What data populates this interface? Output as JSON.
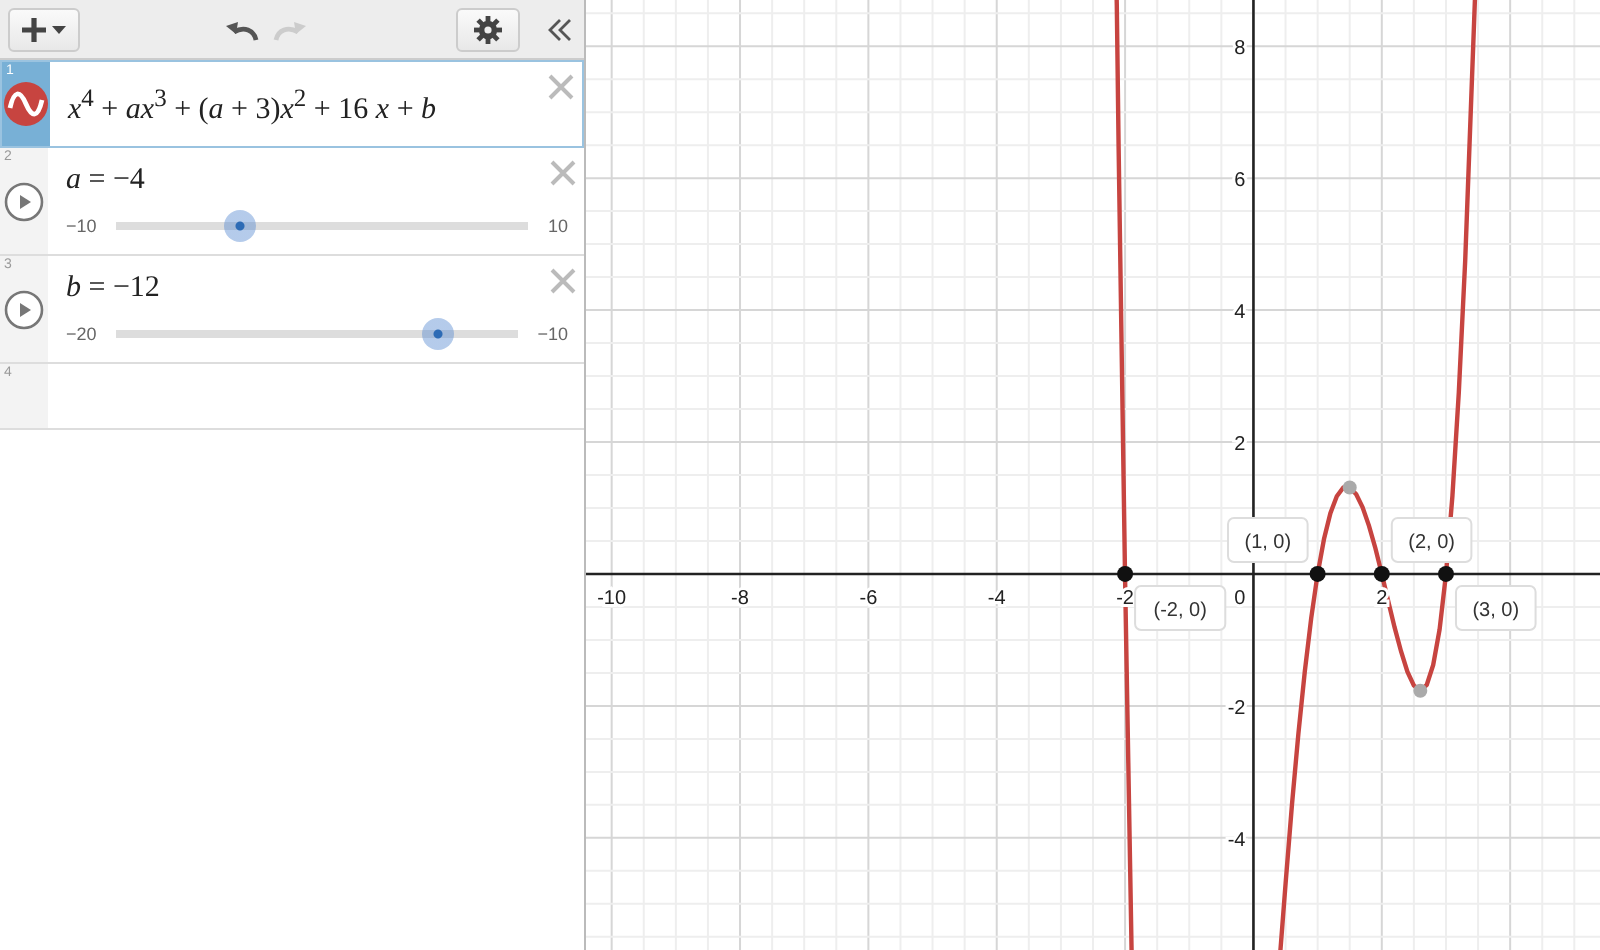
{
  "toolbar": {
    "undo_disabled": false,
    "redo_disabled": true
  },
  "expressions": [
    {
      "kind": "expression",
      "number": "1",
      "selected": true,
      "color": "#c74440",
      "latex": "*x*$^{4}$ + *ax*$^{3}$ + (*a* + 3)*x*$^{2}$ + 16 *x* + *b*"
    },
    {
      "kind": "slider",
      "number": "2",
      "selected": false,
      "latex": "*a* = −4",
      "min": "−10",
      "max": "10",
      "level": 0.3
    },
    {
      "kind": "slider",
      "number": "3",
      "selected": false,
      "latex": "*b* = −12",
      "min": "−20",
      "max": "−10",
      "level": 0.8
    },
    {
      "kind": "empty",
      "number": "4",
      "selected": false
    }
  ],
  "graph": {
    "origin_label": "0",
    "show_extrema": true,
    "chart_data": {
      "type": "line",
      "xlim": [
        -10.4,
        5.4
      ],
      "ylim": [
        -5.7,
        8.7
      ],
      "xticks": [
        -10,
        -8,
        -6,
        -4,
        -2,
        2
      ],
      "yticks": [
        -4,
        -2,
        2,
        4,
        6,
        8
      ],
      "x": [
        -2.13,
        -2.1,
        -2,
        -1.92,
        -1,
        0.43,
        0.5,
        0.6,
        0.7,
        0.8,
        0.9,
        1,
        1.1,
        1.2,
        1.3,
        1.4,
        1.5,
        1.6,
        1.7,
        1.8,
        1.9,
        2,
        2.1,
        2.2,
        2.3,
        2.4,
        2.5,
        2.6,
        2.7,
        2.8,
        2.9,
        3,
        3.1,
        3.2,
        3.3,
        3.44
      ],
      "series": [
        {
          "color": "#c74440",
          "values": [
            8.62,
            6.48,
            0,
            -4.51,
            null,
            -5.59,
            -4.69,
            -3.49,
            -2.42,
            -1.48,
            -0.67,
            0,
            0.53,
            0.92,
            1.18,
            1.31,
            1.31,
            1.21,
            1.01,
            0.73,
            0.39,
            0,
            -0.41,
            -0.81,
            -1.17,
            -1.48,
            -1.69,
            -1.77,
            -1.68,
            -1.38,
            -0.84,
            0,
            1.18,
            2.75,
            4.75,
            8.41
          ]
        }
      ],
      "annotations": [
        {
          "x": -2,
          "y": 0,
          "text": "(-2, 0)"
        },
        {
          "x": 1,
          "y": 0,
          "text": "(1, 0)"
        },
        {
          "x": 2,
          "y": 0,
          "text": "(2, 0)"
        },
        {
          "x": 3,
          "y": 0,
          "text": "(3, 0)"
        }
      ],
      "grid": true
    }
  }
}
